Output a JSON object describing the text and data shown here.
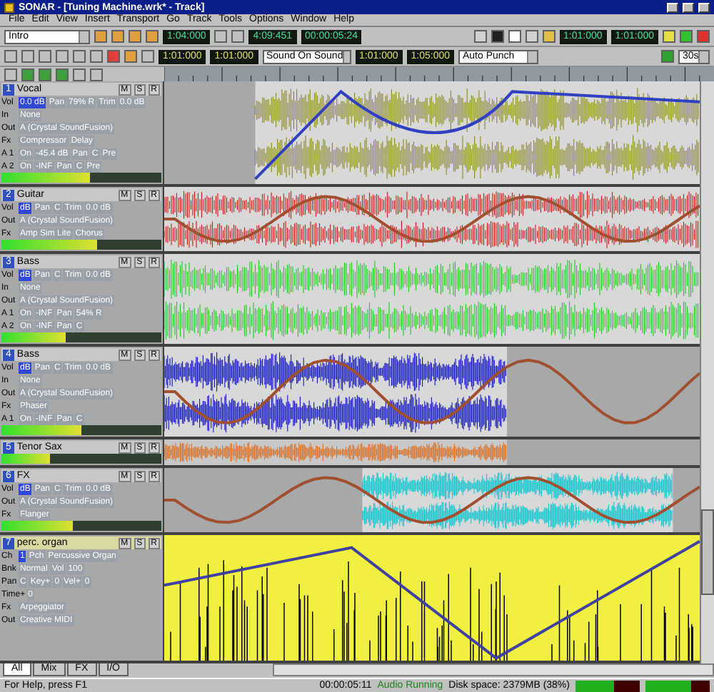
{
  "window": {
    "title": "SONAR - [Tuning Machine.wrk* - Track]"
  },
  "menu": [
    "File",
    "Edit",
    "View",
    "Insert",
    "Transport",
    "Go",
    "Track",
    "Tools",
    "Options",
    "Window",
    "Help"
  ],
  "toolbar": {
    "marker": "Intro",
    "now_time": "1:04:000",
    "big_time": "4:09:451",
    "smpte": "00:00:05:24",
    "loop_start": "1:01:000",
    "loop_end": "1:01:000",
    "loop_from": "1:01:000",
    "loop_to": "1:01:000",
    "record_mode": "Sound On Sound",
    "punch_start": "1:01:000",
    "punch_end": "1:05:000",
    "punch_mode": "Auto Punch",
    "zoom": "30s"
  },
  "tracks": [
    {
      "number": "1",
      "name": "Vocal",
      "kind": "audio",
      "color": "#8a8a1e",
      "buttons": [
        "M",
        "S",
        "R"
      ],
      "level": 0.55,
      "rows": [
        {
          "label": "Vol",
          "fields": [
            "0.0 dB",
            "Pan",
            "79% R",
            "Trim",
            "0.0 dB"
          ]
        },
        {
          "label": "In",
          "fields": [
            "None"
          ]
        },
        {
          "label": "Out",
          "fields": [
            "A (Crystal SoundFusion)"
          ]
        },
        {
          "label": "Fx",
          "fields": [
            "Compressor",
            "Delay"
          ]
        },
        {
          "label": "A 1",
          "fields": [
            "On",
            "-45.4 dB",
            "Pan",
            "C",
            "Pre"
          ]
        },
        {
          "label": "A 2",
          "fields": [
            "On",
            "-INF",
            "Pan",
            "C",
            "Pre"
          ]
        }
      ]
    },
    {
      "number": "2",
      "name": "Guitar",
      "kind": "audio",
      "color": "#d01818",
      "buttons": [
        "M",
        "S",
        "R"
      ],
      "level": 0.6,
      "rows": [
        {
          "label": "Vol",
          "fields": [
            "dB",
            "Pan",
            "C",
            "Trim",
            "0.0 dB"
          ]
        },
        {
          "label": "Out",
          "fields": [
            "A (Crystal SoundFusion)"
          ]
        },
        {
          "label": "Fx",
          "fields": [
            "Amp Sim Lite",
            "Chorus"
          ]
        }
      ]
    },
    {
      "number": "3",
      "name": "Bass",
      "kind": "audio",
      "color": "#20c820",
      "buttons": [
        "M",
        "S",
        "R"
      ],
      "level": 0.4,
      "rows": [
        {
          "label": "Vol",
          "fields": [
            "dB",
            "Pan",
            "C",
            "Trim",
            "0.0 dB"
          ]
        },
        {
          "label": "In",
          "fields": [
            "None"
          ]
        },
        {
          "label": "Out",
          "fields": [
            "A (Crystal SoundFusion)"
          ]
        },
        {
          "label": "A 1",
          "fields": [
            "On",
            "-INF",
            "Pan",
            "54% R"
          ]
        },
        {
          "label": "A 2",
          "fields": [
            "On",
            "-INF",
            "Pan",
            "C"
          ]
        }
      ]
    },
    {
      "number": "4",
      "name": "Bass",
      "kind": "audio",
      "color": "#1818c8",
      "buttons": [
        "M",
        "S",
        "R"
      ],
      "level": 0.5,
      "rows": [
        {
          "label": "Vol",
          "fields": [
            "dB",
            "Pan",
            "C",
            "Trim",
            "0.0 dB"
          ]
        },
        {
          "label": "In",
          "fields": [
            "None"
          ]
        },
        {
          "label": "Out",
          "fields": [
            "A (Crystal SoundFusion)"
          ]
        },
        {
          "label": "Fx",
          "fields": [
            "Phaser"
          ]
        },
        {
          "label": "A 1",
          "fields": [
            "On",
            "-INF",
            "Pan",
            "C"
          ]
        }
      ]
    },
    {
      "number": "5",
      "name": "Tenor Sax",
      "kind": "audio",
      "color": "#e07020",
      "buttons": [
        "M",
        "S",
        "R"
      ],
      "level": 0.3
    },
    {
      "number": "6",
      "name": "FX",
      "kind": "audio",
      "color": "#18c8d0",
      "buttons": [
        "M",
        "S",
        "R"
      ],
      "level": 0.45,
      "rows": [
        {
          "label": "Vol",
          "fields": [
            "dB",
            "Pan",
            "C",
            "Trim",
            "0.0 dB"
          ]
        },
        {
          "label": "Out",
          "fields": [
            "A (Crystal SoundFusion)"
          ]
        },
        {
          "label": "Fx",
          "fields": [
            "Flanger"
          ]
        }
      ]
    },
    {
      "number": "7",
      "name": "perc. organ",
      "kind": "midi",
      "color": "#f0f040",
      "buttons": [
        "M",
        "S",
        "R"
      ],
      "rows": [
        {
          "label": "Ch",
          "fields": [
            "1",
            "Pch",
            "Percussive Organ"
          ]
        },
        {
          "label": "Bnk",
          "fields": [
            "Normal",
            "Vol",
            "100"
          ]
        },
        {
          "label": "Pan",
          "fields": [
            "C",
            "Key+",
            "0",
            "Vel+",
            "0"
          ]
        },
        {
          "label": "Time+",
          "fields": [
            "0"
          ]
        },
        {
          "label": "Fx",
          "fields": [
            "Arpeggiator"
          ]
        },
        {
          "label": "Out",
          "fields": [
            "Creative MIDI"
          ]
        }
      ]
    }
  ],
  "tabs": [
    {
      "label": "All",
      "selected": true
    },
    {
      "label": "Mix",
      "selected": false
    },
    {
      "label": "FX",
      "selected": false
    },
    {
      "label": "I/O",
      "selected": false
    }
  ],
  "status_bar": {
    "help": "For Help, press F1",
    "time": "00:00:05:11",
    "audio": "Audio Running",
    "disk": "Disk space: 2379MB (38%)",
    "cpu_meter": {
      "level": 0.6
    },
    "disk_meter": {
      "level": 0.7
    }
  }
}
